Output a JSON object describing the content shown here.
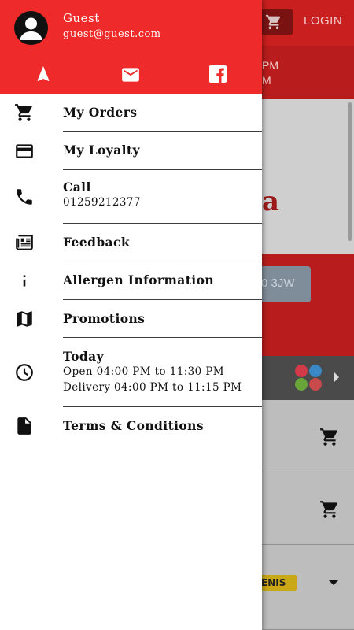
{
  "background": {
    "login_label": "LOGIN",
    "hours_line1": "PM",
    "hours_line2": "M",
    "hero_letter": "a",
    "postcode_fragment": "0 3JW",
    "badge_fragment": "ENIS"
  },
  "drawer": {
    "user": {
      "name": "Guest",
      "email": "guest@guest.com"
    },
    "header_icons": [
      "navigation-icon",
      "mail-icon",
      "facebook-icon"
    ],
    "items": [
      {
        "label": "My Orders",
        "icon": "cart-icon"
      },
      {
        "label": "My Loyalty",
        "icon": "credit-card-icon"
      },
      {
        "label": "Call",
        "sub": "01259212377",
        "icon": "phone-icon"
      },
      {
        "label": "Feedback",
        "icon": "newspaper-icon"
      },
      {
        "label": "Allergen Information",
        "icon": "info-icon"
      },
      {
        "label": "Promotions",
        "icon": "map-icon"
      },
      {
        "label": "Today",
        "sub": "Open 04:00 PM to 11:30 PM",
        "sub2": "Delivery 04:00 PM to 11:15 PM",
        "icon": "clock-icon"
      },
      {
        "label": "Terms & Conditions",
        "icon": "document-icon"
      }
    ]
  },
  "colors": {
    "drawer_header": "#ee2a2a",
    "brand_red": "#c91f1f"
  }
}
